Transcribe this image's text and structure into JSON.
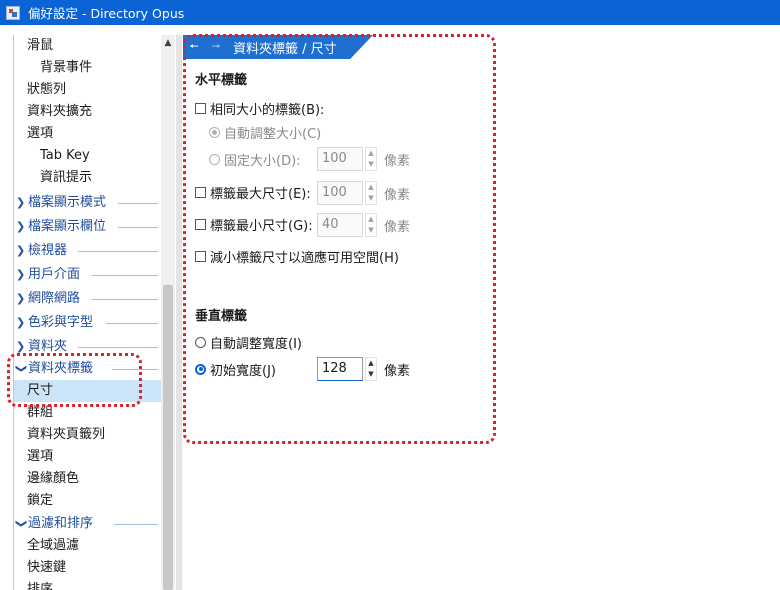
{
  "window": {
    "title": "偏好設定 - Directory Opus"
  },
  "sidebar": {
    "items": [
      {
        "label": "滑鼠",
        "level": 1
      },
      {
        "label": "背景事件",
        "level": 2
      },
      {
        "label": "狀態列",
        "level": 1
      },
      {
        "label": "資料夾擴充",
        "level": 1
      },
      {
        "label": "選項",
        "level": 1
      },
      {
        "label": "Tab Key",
        "level": 2
      },
      {
        "label": "資訊提示",
        "level": 2
      },
      {
        "label": "檔案顯示模式",
        "level": "group",
        "expanded": false
      },
      {
        "label": "檔案顯示欄位",
        "level": "group",
        "expanded": false
      },
      {
        "label": "檢視器",
        "level": "group",
        "expanded": false
      },
      {
        "label": "用戶介面",
        "level": "group",
        "expanded": false
      },
      {
        "label": "網際網路",
        "level": "group",
        "expanded": false
      },
      {
        "label": "色彩與字型",
        "level": "group",
        "expanded": false
      },
      {
        "label": "資料夾",
        "level": "group",
        "expanded": false
      },
      {
        "label": "資料夾標籤",
        "level": "group",
        "expanded": true
      },
      {
        "label": "尺寸",
        "level": 1,
        "selected": true
      },
      {
        "label": "群組",
        "level": 1
      },
      {
        "label": "資料夾頁籤列",
        "level": 1
      },
      {
        "label": "選項",
        "level": 1
      },
      {
        "label": "邊緣顏色",
        "level": 1
      },
      {
        "label": "鎖定",
        "level": 1
      },
      {
        "label": "過濾和排序",
        "level": "group",
        "expanded": true
      },
      {
        "label": "全域過濾",
        "level": 1
      },
      {
        "label": "快速鍵",
        "level": 1
      },
      {
        "label": "排序",
        "level": 1
      }
    ]
  },
  "header": {
    "breadcrumb": "資料夾標籤 / 尺寸",
    "back_icon": "arrow-left-icon",
    "forward_icon": "arrow-right-icon"
  },
  "horizontal": {
    "title": "水平標籤",
    "same_size_label": "相同大小的標籤(B):",
    "auto_size_label": "自動調整大小(C)",
    "fixed_size_label": "固定大小(D):",
    "fixed_size_value": "100",
    "max_size_label": "標籤最大尺寸(E):",
    "max_size_value": "100",
    "min_size_label": "標籤最小尺寸(G):",
    "min_size_value": "40",
    "shrink_label": "減小標籤尺寸以適應可用空間(H)",
    "unit": "像素"
  },
  "vertical": {
    "title": "垂直標籤",
    "auto_width_label": "自動調整寬度(I)",
    "initial_width_label": "初始寬度(J)",
    "initial_width_value": "128",
    "unit": "像素"
  },
  "colors": {
    "titlebar": "#0b63d6",
    "accent": "#1e6fd0",
    "selection": "#cce4f7",
    "highlight": "#d4242c",
    "group_text": "#1f4d9e"
  }
}
